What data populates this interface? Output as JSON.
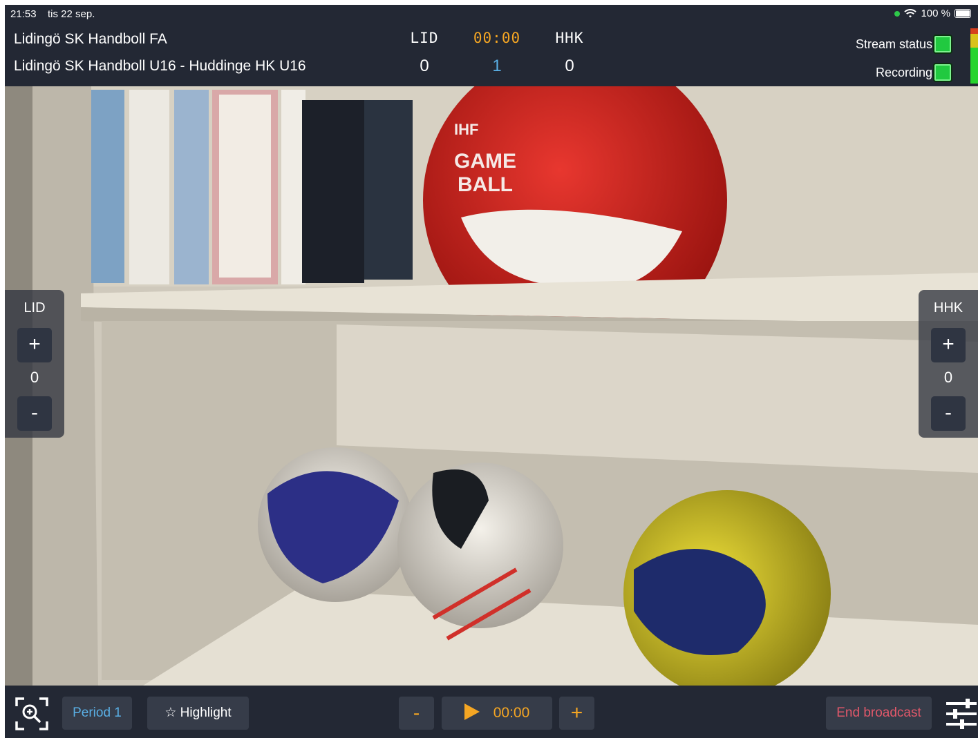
{
  "status_bar": {
    "time": "21:53",
    "date": "tis 22 sep.",
    "battery": "100 %"
  },
  "header": {
    "organization": "Lidingö SK Handboll FA",
    "match": "Lidingö SK Handboll U16 - Huddinge HK U16",
    "home_abbr": "LID",
    "away_abbr": "HHK",
    "clock": "00:00",
    "home_score": "0",
    "away_score": "0",
    "period": "1",
    "stream_status_label": "Stream status",
    "recording_label": "Recording",
    "accent_clock": "#f5a623",
    "accent_period": "#5ab0e6",
    "status_ok_color": "#21c940"
  },
  "left_panel": {
    "label": "LID",
    "plus": "+",
    "value": "0",
    "minus": "-"
  },
  "right_panel": {
    "label": "HHK",
    "plus": "+",
    "value": "0",
    "minus": "-"
  },
  "toolbar": {
    "zoom_icon": "zoom-in-icon",
    "period_button": "Period 1",
    "highlight_button": "☆ Highlight",
    "minus": "-",
    "clock": "00:00",
    "plus": "+",
    "end_broadcast": "End broadcast",
    "settings_icon": "sliders-icon",
    "end_color": "#e2586a"
  }
}
